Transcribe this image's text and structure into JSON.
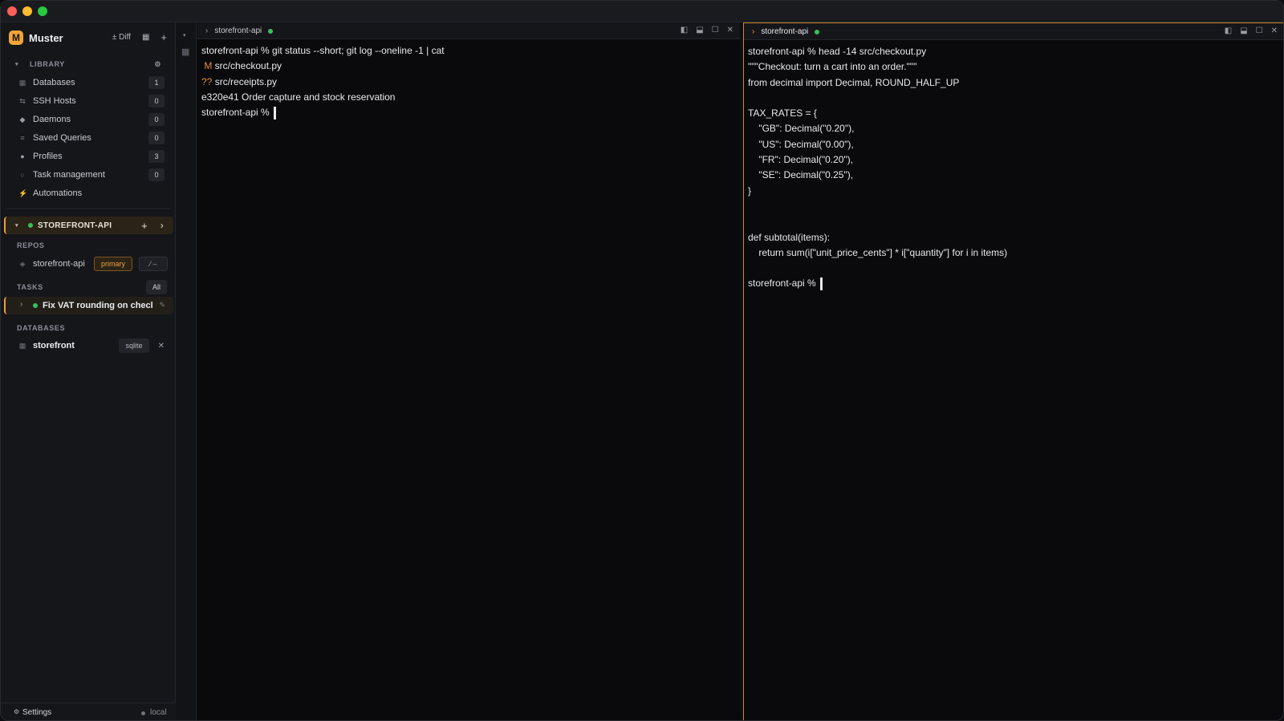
{
  "app": {
    "name": "Muster",
    "logo_letter": "M"
  },
  "brand_actions": {
    "diff": "± Diff",
    "layout_icon": "grid-icon",
    "add": "+"
  },
  "library": {
    "heading": "LIBRARY",
    "items": [
      {
        "label": "Databases",
        "count": "1",
        "icon": "database-icon"
      },
      {
        "label": "SSH Hosts",
        "count": "0",
        "icon": "ssh-icon"
      },
      {
        "label": "Daemons",
        "count": "0",
        "icon": "diamond-icon"
      },
      {
        "label": "Saved Queries",
        "count": "0",
        "icon": "query-icon"
      },
      {
        "label": "Profiles",
        "count": "3",
        "icon": "profile-icon"
      },
      {
        "label": "Task management",
        "count": "0",
        "icon": "task-icon"
      },
      {
        "label": "Automations",
        "count": "",
        "icon": "bolt-icon"
      }
    ]
  },
  "project": {
    "name": "STOREFRONT-API",
    "add": "+",
    "more": "›"
  },
  "repos": {
    "heading": "REPOS",
    "name": "storefront-api",
    "badge": "primary",
    "action": "⁄ –"
  },
  "tasks": {
    "heading": "TASKS",
    "filter": "All",
    "item": "Fix VAT rounding on checkout"
  },
  "databases": {
    "heading": "DATABASES",
    "name": "storefront",
    "engine": "sqlite",
    "remove": "✕"
  },
  "footer": {
    "settings": "Settings",
    "status": "local"
  },
  "pane_left": {
    "title": "storefront-api",
    "lines": [
      {
        "prefix": "",
        "text": "storefront-api % git status --short; git log --oneline -1 | cat"
      },
      {
        "prefix": " M",
        "text": " src/checkout.py"
      },
      {
        "prefix": "??",
        "text": " src/receipts.py"
      },
      {
        "prefix": "",
        "text": "e320e41 Order capture and stock reservation"
      }
    ],
    "prompt": "storefront-api % "
  },
  "pane_right": {
    "title": "storefront-api",
    "lines": [
      "storefront-api % head -14 src/checkout.py",
      "\"\"\"Checkout: turn a cart into an order.\"\"\"",
      "from decimal import Decimal, ROUND_HALF_UP",
      "",
      "TAX_RATES = {",
      "    \"GB\": Decimal(\"0.20\"),",
      "    \"US\": Decimal(\"0.00\"),",
      "    \"FR\": Decimal(\"0.20\"),",
      "    \"SE\": Decimal(\"0.25\"),",
      "}",
      "",
      "",
      "def subtotal(items):",
      "    return sum(i[\"unit_price_cents\"] * i[\"quantity\"] for i in items)",
      ""
    ],
    "prompt": "storefront-api % "
  },
  "colors": {
    "accent": "#e8a13a",
    "status_green": "#37c05a",
    "modified": "#e08a3c"
  }
}
